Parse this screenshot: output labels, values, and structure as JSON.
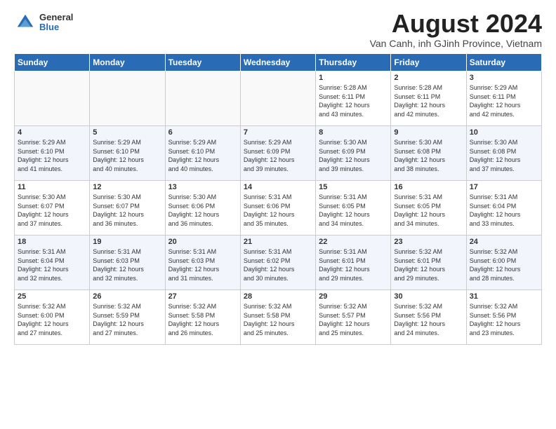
{
  "logo": {
    "text_general": "General",
    "text_blue": "Blue"
  },
  "header": {
    "month": "August 2024",
    "location": "Van Canh, inh GJinh Province, Vietnam"
  },
  "weekdays": [
    "Sunday",
    "Monday",
    "Tuesday",
    "Wednesday",
    "Thursday",
    "Friday",
    "Saturday"
  ],
  "weeks": [
    [
      {
        "day": "",
        "text": ""
      },
      {
        "day": "",
        "text": ""
      },
      {
        "day": "",
        "text": ""
      },
      {
        "day": "",
        "text": ""
      },
      {
        "day": "1",
        "text": "Sunrise: 5:28 AM\nSunset: 6:11 PM\nDaylight: 12 hours\nand 43 minutes."
      },
      {
        "day": "2",
        "text": "Sunrise: 5:28 AM\nSunset: 6:11 PM\nDaylight: 12 hours\nand 42 minutes."
      },
      {
        "day": "3",
        "text": "Sunrise: 5:29 AM\nSunset: 6:11 PM\nDaylight: 12 hours\nand 42 minutes."
      }
    ],
    [
      {
        "day": "4",
        "text": "Sunrise: 5:29 AM\nSunset: 6:10 PM\nDaylight: 12 hours\nand 41 minutes."
      },
      {
        "day": "5",
        "text": "Sunrise: 5:29 AM\nSunset: 6:10 PM\nDaylight: 12 hours\nand 40 minutes."
      },
      {
        "day": "6",
        "text": "Sunrise: 5:29 AM\nSunset: 6:10 PM\nDaylight: 12 hours\nand 40 minutes."
      },
      {
        "day": "7",
        "text": "Sunrise: 5:29 AM\nSunset: 6:09 PM\nDaylight: 12 hours\nand 39 minutes."
      },
      {
        "day": "8",
        "text": "Sunrise: 5:30 AM\nSunset: 6:09 PM\nDaylight: 12 hours\nand 39 minutes."
      },
      {
        "day": "9",
        "text": "Sunrise: 5:30 AM\nSunset: 6:08 PM\nDaylight: 12 hours\nand 38 minutes."
      },
      {
        "day": "10",
        "text": "Sunrise: 5:30 AM\nSunset: 6:08 PM\nDaylight: 12 hours\nand 37 minutes."
      }
    ],
    [
      {
        "day": "11",
        "text": "Sunrise: 5:30 AM\nSunset: 6:07 PM\nDaylight: 12 hours\nand 37 minutes."
      },
      {
        "day": "12",
        "text": "Sunrise: 5:30 AM\nSunset: 6:07 PM\nDaylight: 12 hours\nand 36 minutes."
      },
      {
        "day": "13",
        "text": "Sunrise: 5:30 AM\nSunset: 6:06 PM\nDaylight: 12 hours\nand 36 minutes."
      },
      {
        "day": "14",
        "text": "Sunrise: 5:31 AM\nSunset: 6:06 PM\nDaylight: 12 hours\nand 35 minutes."
      },
      {
        "day": "15",
        "text": "Sunrise: 5:31 AM\nSunset: 6:05 PM\nDaylight: 12 hours\nand 34 minutes."
      },
      {
        "day": "16",
        "text": "Sunrise: 5:31 AM\nSunset: 6:05 PM\nDaylight: 12 hours\nand 34 minutes."
      },
      {
        "day": "17",
        "text": "Sunrise: 5:31 AM\nSunset: 6:04 PM\nDaylight: 12 hours\nand 33 minutes."
      }
    ],
    [
      {
        "day": "18",
        "text": "Sunrise: 5:31 AM\nSunset: 6:04 PM\nDaylight: 12 hours\nand 32 minutes."
      },
      {
        "day": "19",
        "text": "Sunrise: 5:31 AM\nSunset: 6:03 PM\nDaylight: 12 hours\nand 32 minutes."
      },
      {
        "day": "20",
        "text": "Sunrise: 5:31 AM\nSunset: 6:03 PM\nDaylight: 12 hours\nand 31 minutes."
      },
      {
        "day": "21",
        "text": "Sunrise: 5:31 AM\nSunset: 6:02 PM\nDaylight: 12 hours\nand 30 minutes."
      },
      {
        "day": "22",
        "text": "Sunrise: 5:31 AM\nSunset: 6:01 PM\nDaylight: 12 hours\nand 29 minutes."
      },
      {
        "day": "23",
        "text": "Sunrise: 5:32 AM\nSunset: 6:01 PM\nDaylight: 12 hours\nand 29 minutes."
      },
      {
        "day": "24",
        "text": "Sunrise: 5:32 AM\nSunset: 6:00 PM\nDaylight: 12 hours\nand 28 minutes."
      }
    ],
    [
      {
        "day": "25",
        "text": "Sunrise: 5:32 AM\nSunset: 6:00 PM\nDaylight: 12 hours\nand 27 minutes."
      },
      {
        "day": "26",
        "text": "Sunrise: 5:32 AM\nSunset: 5:59 PM\nDaylight: 12 hours\nand 27 minutes."
      },
      {
        "day": "27",
        "text": "Sunrise: 5:32 AM\nSunset: 5:58 PM\nDaylight: 12 hours\nand 26 minutes."
      },
      {
        "day": "28",
        "text": "Sunrise: 5:32 AM\nSunset: 5:58 PM\nDaylight: 12 hours\nand 25 minutes."
      },
      {
        "day": "29",
        "text": "Sunrise: 5:32 AM\nSunset: 5:57 PM\nDaylight: 12 hours\nand 25 minutes."
      },
      {
        "day": "30",
        "text": "Sunrise: 5:32 AM\nSunset: 5:56 PM\nDaylight: 12 hours\nand 24 minutes."
      },
      {
        "day": "31",
        "text": "Sunrise: 5:32 AM\nSunset: 5:56 PM\nDaylight: 12 hours\nand 23 minutes."
      }
    ]
  ]
}
